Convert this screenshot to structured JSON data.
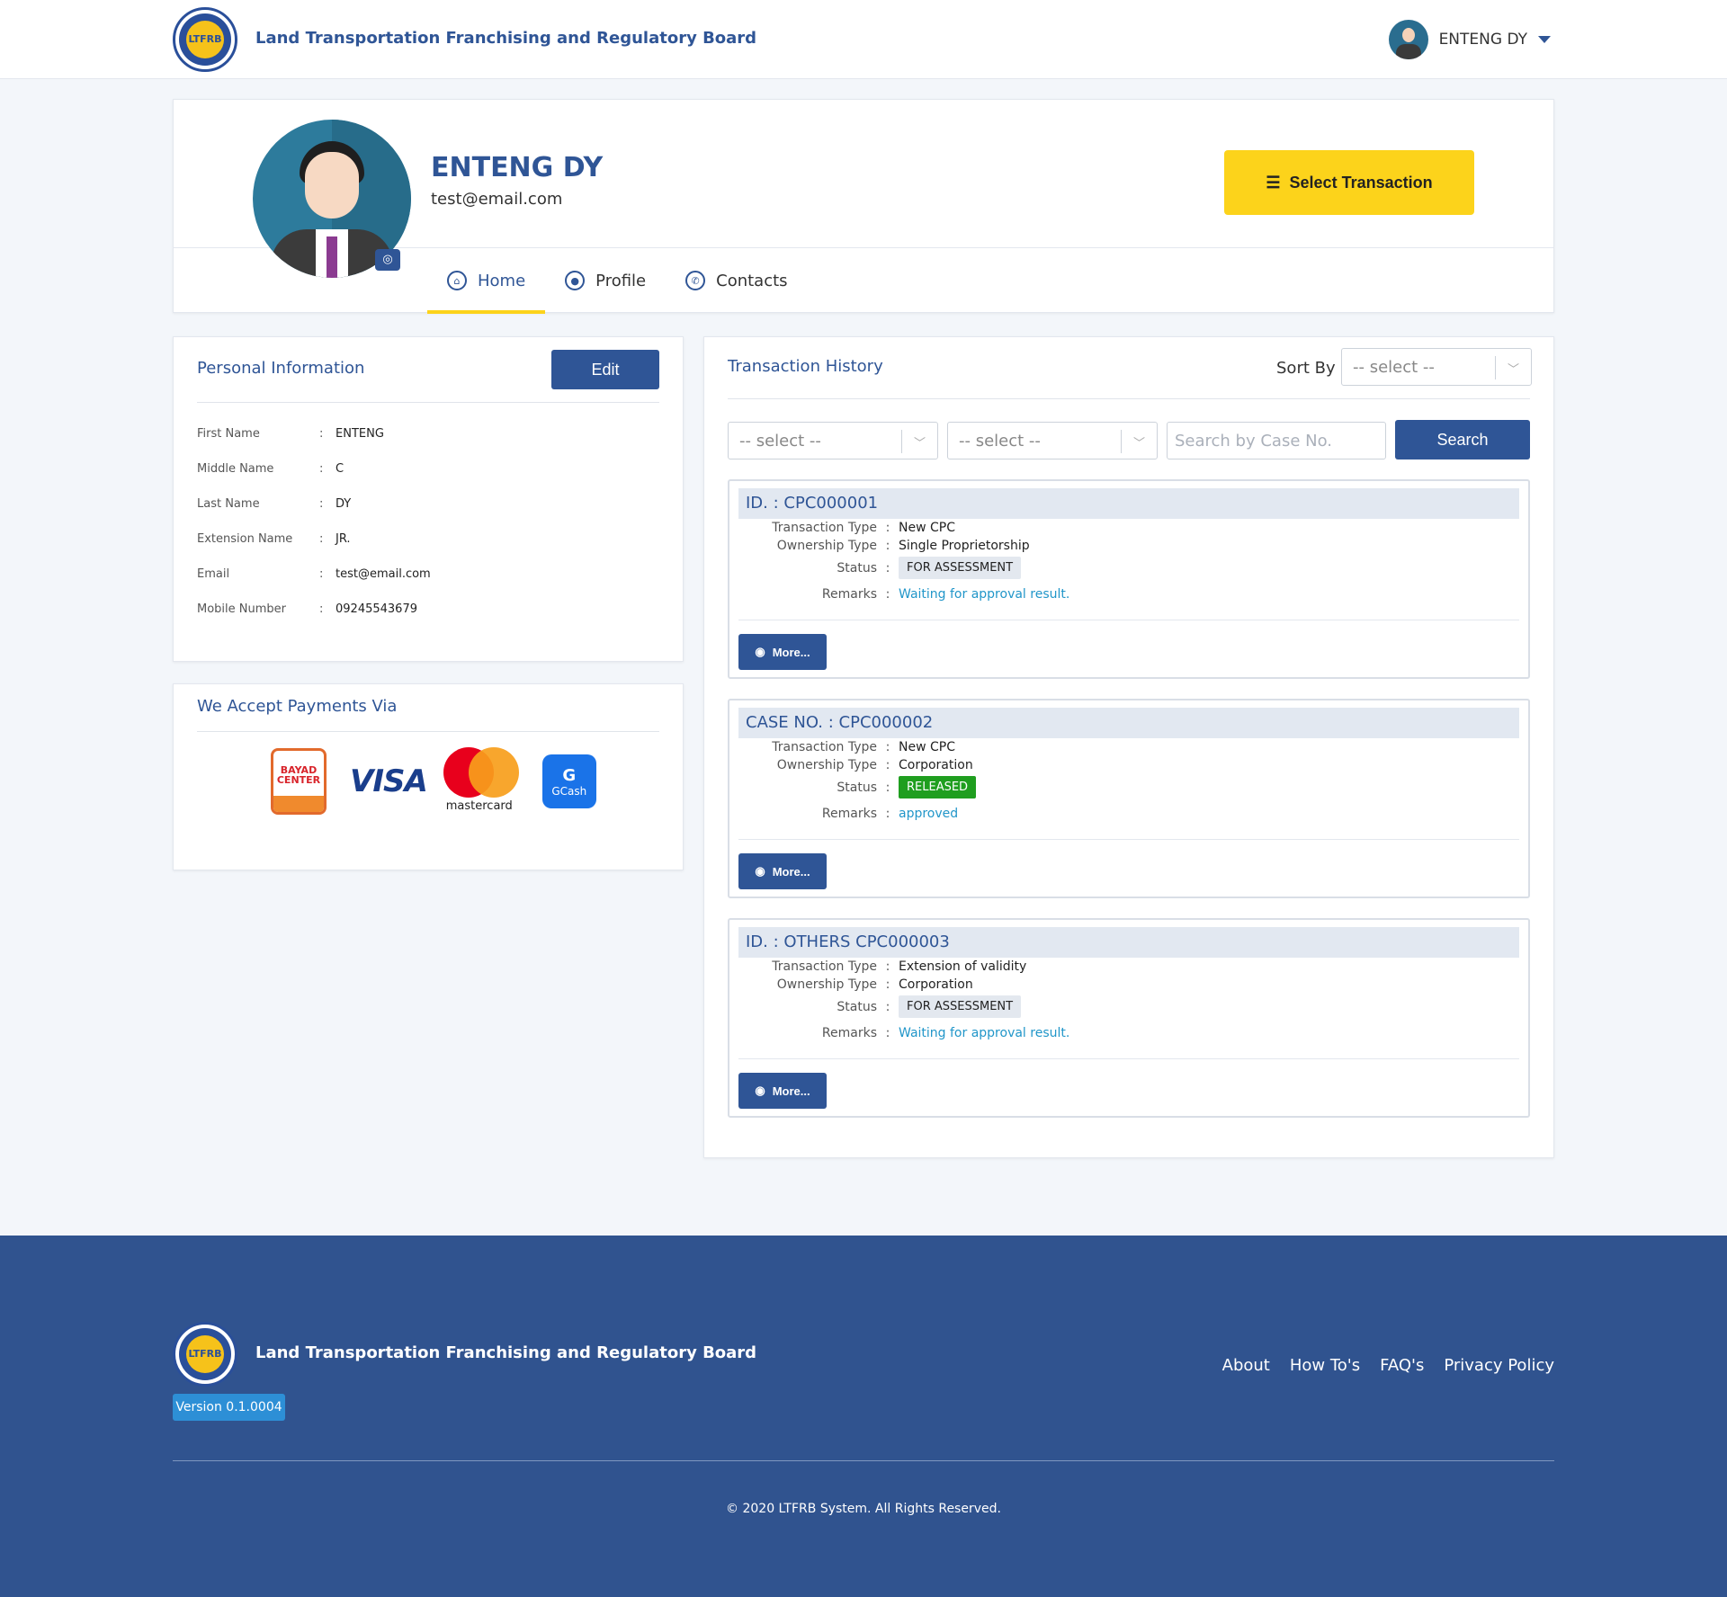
{
  "header": {
    "logo_text": "LTFRB",
    "org_name": "Land Transportation Franchising and Regulatory Board",
    "user_name": "ENTENG DY"
  },
  "profile": {
    "name": "ENTENG DY",
    "email": "test@email.com",
    "select_transaction_label": "Select Transaction",
    "tabs": [
      {
        "label": "Home",
        "icon": "home-icon",
        "active": true
      },
      {
        "label": "Profile",
        "icon": "user-icon",
        "active": false
      },
      {
        "label": "Contacts",
        "icon": "contacts-icon",
        "active": false
      }
    ]
  },
  "personal_info": {
    "title": "Personal Information",
    "edit_label": "Edit",
    "fields": [
      {
        "label": "First Name",
        "value": "ENTENG"
      },
      {
        "label": "Middle Name",
        "value": "C"
      },
      {
        "label": "Last Name",
        "value": "DY"
      },
      {
        "label": "Extension Name",
        "value": "JR."
      },
      {
        "label": "Email",
        "value": "test@email.com"
      },
      {
        "label": "Mobile Number",
        "value": "09245543679"
      }
    ]
  },
  "payments": {
    "title": "We Accept Payments Via",
    "bayad_text": "BAYAD CENTER",
    "visa_text": "VISA",
    "mastercard_text": "mastercard",
    "gcash_text": "GCash"
  },
  "history": {
    "title": "Transaction History",
    "sort_by_label": "Sort By",
    "sort_placeholder": "-- select --",
    "filter1_placeholder": "-- select --",
    "filter2_placeholder": "-- select --",
    "search_placeholder": "Search by Case No.",
    "search_label": "Search",
    "more_label": "More...",
    "transactions": [
      {
        "heading": "ID. : CPC000001",
        "type_label": "Transaction Type",
        "type": "New CPC",
        "ownership_label": "Ownership Type",
        "ownership": "Single Proprietorship",
        "status_label": "Status",
        "status": "FOR ASSESSMENT",
        "remarks_label": "Remarks",
        "remarks": "Waiting for approval result."
      },
      {
        "heading": "CASE NO. : CPC000002",
        "type_label": "Transaction Type",
        "type": "New CPC",
        "ownership_label": "Ownership Type",
        "ownership": "Corporation",
        "status_label": "Status",
        "status": "RELEASED",
        "remarks_label": "Remarks",
        "remarks": "approved"
      },
      {
        "heading": "ID. : OTHERS CPC000003",
        "type_label": "Transaction Type",
        "type": "Extension of validity",
        "ownership_label": "Ownership Type",
        "ownership": "Corporation",
        "status_label": "Status",
        "status": "FOR ASSESSMENT",
        "remarks_label": "Remarks",
        "remarks": "Waiting for approval result."
      }
    ]
  },
  "footer": {
    "logo_text": "LTFRB",
    "org_name": "Land Transportation Franchising and Regulatory Board",
    "version": "Version 0.1.0004",
    "links": [
      "About",
      "How To's",
      "FAQ's",
      "Privacy Policy"
    ],
    "copyright": "© 2020 LTFRB System. All Rights Reserved."
  },
  "colors": {
    "primary": "#2f5596",
    "accent": "#fcd31b",
    "released": "#1f9e1f",
    "link": "#2196c9"
  }
}
